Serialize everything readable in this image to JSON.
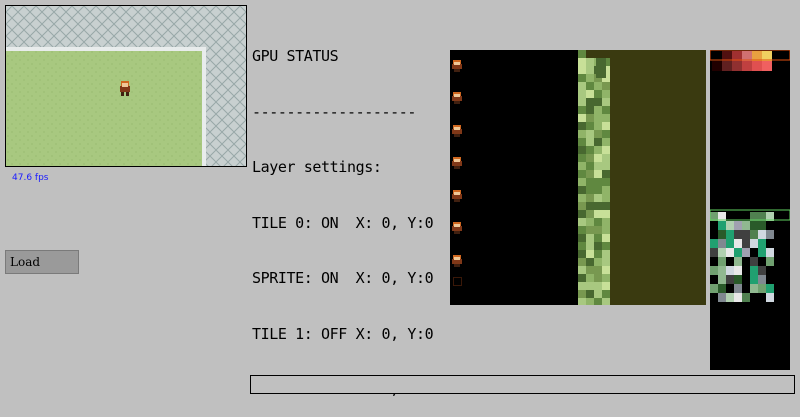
{
  "game": {
    "fps_label": "47.6 fps"
  },
  "controls": {
    "load_label": "Load"
  },
  "gpu_status": {
    "title": "GPU STATUS",
    "divider": "-------------------",
    "layer_heading": "Layer settings:",
    "layers": [
      "TILE 0: ON  X: 0, Y:0",
      "SPRITE: ON  X: 0, Y:0",
      "TILE 1: OFF X: 0, Y:0",
      "WINDOW: OFF X: 0, Y:0"
    ]
  },
  "colors": {
    "background": "#c0c0c0",
    "grass": "#a8c880",
    "stone": "#c8d0d0",
    "fps_text": "#1a1aff",
    "tile_olive": "#3a3a10"
  }
}
